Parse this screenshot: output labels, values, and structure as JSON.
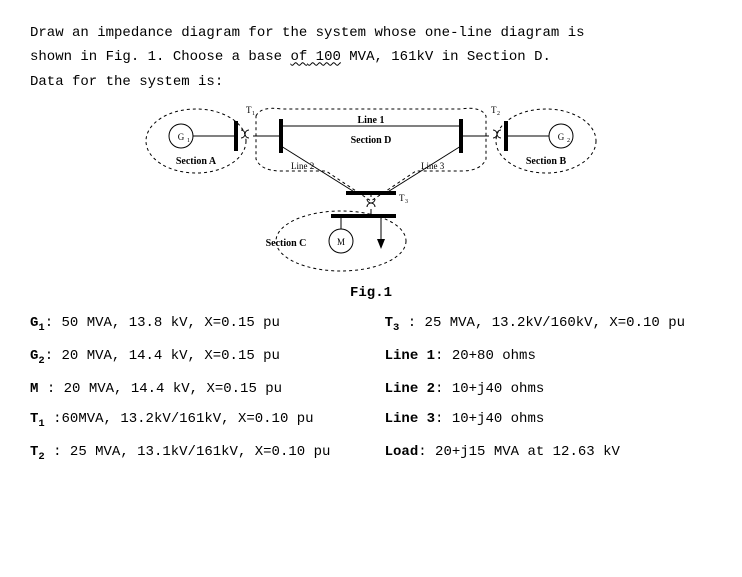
{
  "prompt": {
    "line1_a": "Draw an impedance diagram for the system whose one-line diagram is",
    "line2_a": "shown in Fig. 1. Choose a base ",
    "line2_of": "of",
    "line2_100": "  100",
    "line2_b": " MVA,  161kV in Section D.",
    "line3": "Data for the system is:"
  },
  "fig": {
    "G1": "G₁",
    "G2": "G₂",
    "M": "M",
    "T1": "T₁",
    "T2": "T₂",
    "T3": "T₃",
    "SectionA": "Section A",
    "SectionB": "Section B",
    "SectionC": "Section C",
    "SectionD": "Section D",
    "Line1": "Line 1",
    "Line2": "Line 2",
    "Line3": "Line 3",
    "caption": "Fig.1"
  },
  "data": {
    "G1": "G₁: 50 MVA, 13.8 kV, X=0.15 pu",
    "G2": "G₂: 20 MVA, 14.4 kV, X=0.15 pu",
    "M": "M : 20 MVA, 14.4 kV, X=0.15 pu",
    "T1": "T₁ :60MVA, 13.2kV/161kV, X=0.10 pu",
    "T2": "T₂ : 25 MVA, 13.1kV/161kV, X=0.10 pu",
    "T3": "T₃ : 25 MVA, 13.2kV/160kV, X=0.10 pu",
    "L1": "Line 1: 20+80 ohms",
    "L2": "Line 2: 10+j40 ohms",
    "L3": "Line 3: 10+j40 ohms",
    "Load": "Load: 20+j15 MVA at 12.63 kV"
  }
}
